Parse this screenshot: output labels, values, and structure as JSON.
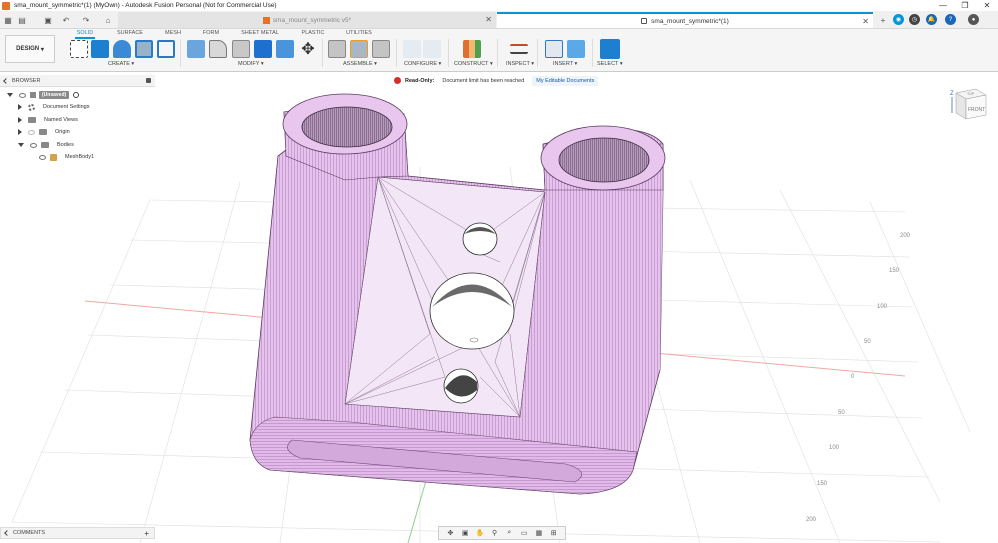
{
  "window": {
    "title": "sma_mount_symmetric*(1) (MyOwn) - Autodesk Fusion Personal (Not for Commercial Use)",
    "minimize": "—",
    "maximize": "❐",
    "close": "✕"
  },
  "tabs": [
    {
      "label": "sma_mount_symmetric v5*",
      "active": false
    },
    {
      "label": "sma_mount_symmetric*(1)",
      "active": true
    }
  ],
  "toolbar": {
    "design_label": "DESIGN",
    "workspace_tabs": [
      "SOLID",
      "SURFACE",
      "MESH",
      "FORM",
      "SHEET METAL",
      "PLASTIC",
      "UTILITIES"
    ],
    "groups": [
      "CREATE",
      "MODIFY",
      "ASSEMBLE",
      "CONFIGURE",
      "CONSTRUCT",
      "INSPECT",
      "INSERT",
      "SELECT"
    ]
  },
  "browser": {
    "title": "BROWSER",
    "root": "(Unsaved)",
    "items": [
      "Document Settings",
      "Named Views",
      "Origin",
      "Bodies",
      "MeshBody1"
    ]
  },
  "banner": {
    "readonly": "Read-Only:",
    "message": "Document limit has been reached",
    "link": "My Editable Documents"
  },
  "viewcube": {
    "top": "TOP",
    "front": "FRONT",
    "axis_z": "Z",
    "axis_x": "X"
  },
  "grid_labels": {
    "right_top": [
      "200",
      "150",
      "100",
      "50"
    ],
    "right_zero": "0",
    "right_bottom": [
      "50",
      "100",
      "150",
      "200"
    ]
  },
  "comments": {
    "label": "COMMENTS",
    "add": "+"
  },
  "colors": {
    "accent": "#0696d7",
    "model": "#e3b9eb",
    "grid": "#dcdcdc"
  }
}
